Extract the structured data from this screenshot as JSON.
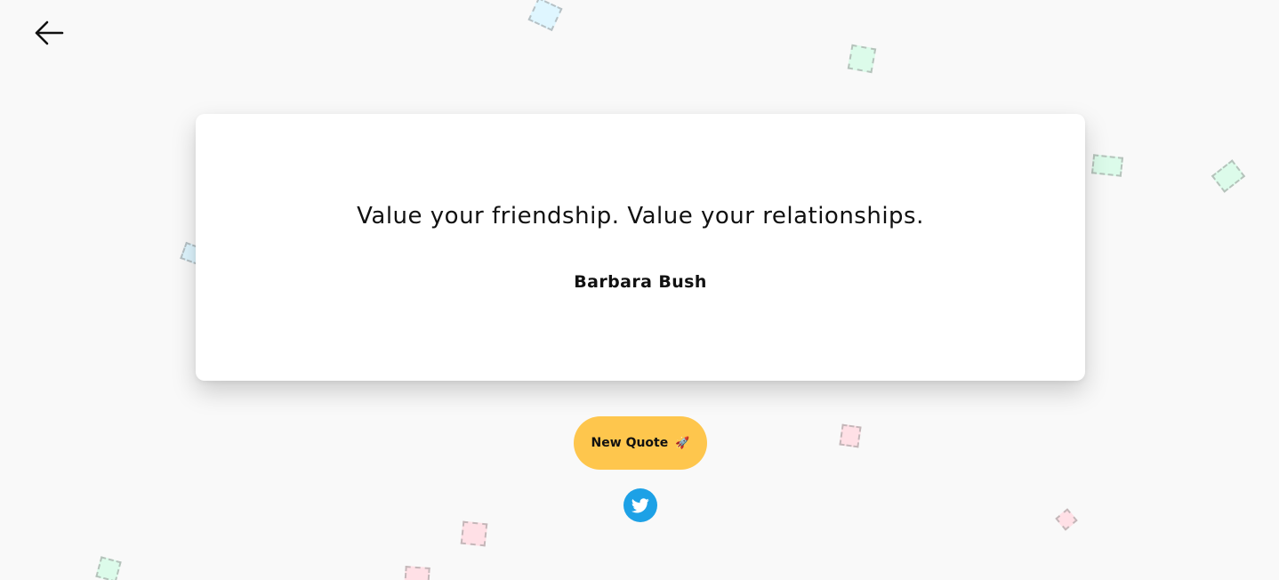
{
  "quote": {
    "text": "Value your friendship. Value your relationships.",
    "author": "Barbara Bush"
  },
  "actions": {
    "new_quote_label": "New Quote",
    "new_quote_emoji": "🚀",
    "twitter_icon": "twitter-icon",
    "back_icon": "arrow-left-icon"
  },
  "colors": {
    "background": "#f9f9f9",
    "card": "#ffffff",
    "button": "#fec64d",
    "twitter": "#1da1e6",
    "confetti_blue": "#dff6ff",
    "confetti_green": "#dcfbea",
    "confetti_pink": "#ffe0e6"
  }
}
